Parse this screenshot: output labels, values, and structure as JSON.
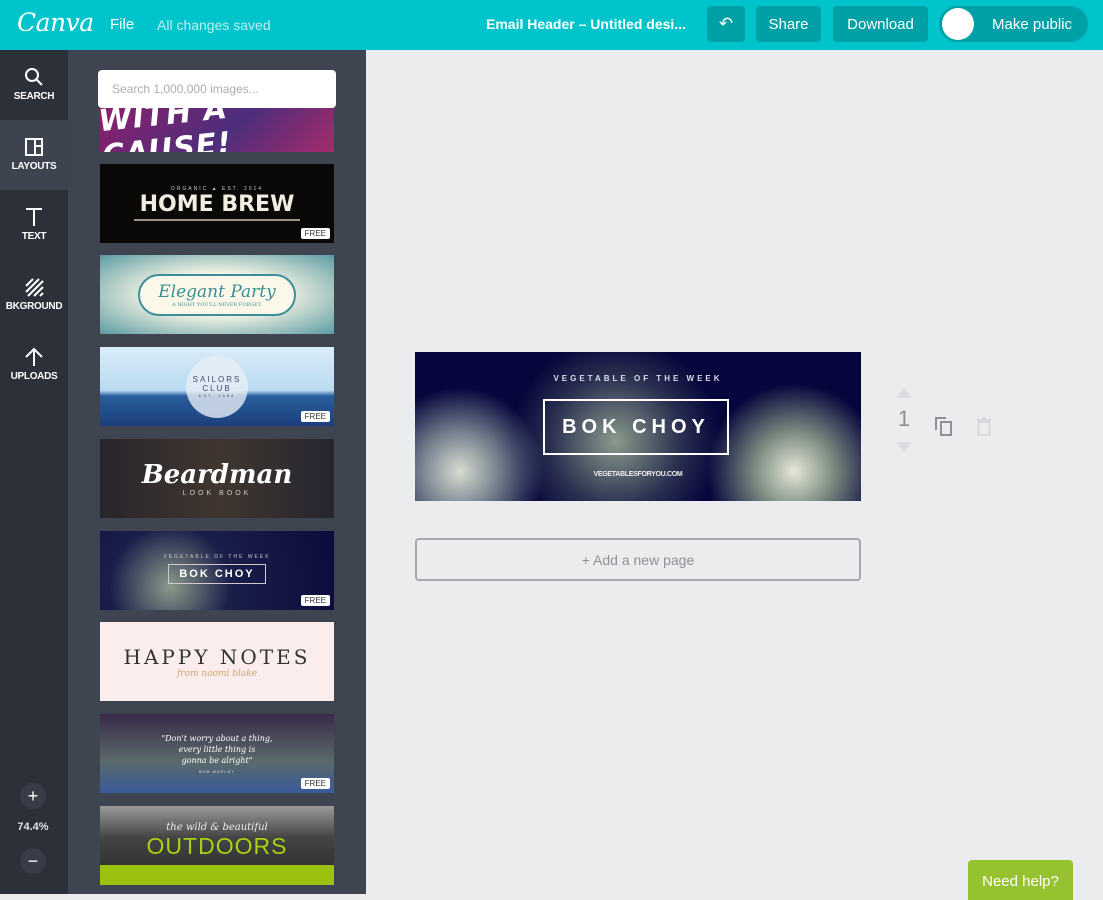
{
  "topbar": {
    "logo": "Canva",
    "file_menu": "File",
    "save_status": "All changes saved",
    "document_title": "Email Header – Untitled desi...",
    "undo_icon": "↶",
    "share_label": "Share",
    "download_label": "Download",
    "make_public_label": "Make public",
    "make_public_enabled": false,
    "colors": {
      "brand": "#00c4cc",
      "button": "#00a0a7"
    }
  },
  "rail": {
    "items": [
      {
        "label": "SEARCH",
        "icon": "search-icon"
      },
      {
        "label": "LAYOUTS",
        "icon": "layouts-icon",
        "active": true
      },
      {
        "label": "TEXT",
        "icon": "text-icon"
      },
      {
        "label": "BKGROUND",
        "icon": "background-icon"
      },
      {
        "label": "UPLOADS",
        "icon": "upload-icon"
      }
    ],
    "zoom_in": "+",
    "zoom_level": "74.4%",
    "zoom_out": "−"
  },
  "panel": {
    "search_placeholder": "Search 1,000,000 images...",
    "free_badge": "FREE",
    "layouts": [
      {
        "title": "WITH A CAUSE!",
        "free": false
      },
      {
        "small_left": "ORGANIC",
        "small_right": "EST. 2014",
        "title": "HOME BREW",
        "free": true
      },
      {
        "title": "Elegant Party",
        "subtitle": "A NIGHT YOU'LL NEVER FORGET.",
        "free": false
      },
      {
        "title": "SAILORS",
        "title2": "CLUB",
        "subtitle": "EST. 1984",
        "free": true
      },
      {
        "title": "Beardman",
        "subtitle": "LOOK BOOK",
        "free": false
      },
      {
        "kicker": "VEGETABLE OF THE WEEK",
        "title": "BOK CHOY",
        "free": true
      },
      {
        "title": "HAPPY NOTES",
        "subtitle": "from naomi blake",
        "free": false
      },
      {
        "quote_line1": "\"Don't worry about a thing,",
        "quote_line2": "every little thing is",
        "quote_line3": "gonna be alright\"",
        "author": "BOB MARLEY",
        "free": true
      },
      {
        "kicker": "the wild & beautiful",
        "title": "OUTDOORS",
        "free": false
      }
    ]
  },
  "canvas": {
    "design": {
      "kicker": "VEGETABLE OF THE WEEK",
      "headline": "BOK CHOY",
      "website": "VEGETABLESFORYOU.COM"
    },
    "page_number": "1",
    "add_page_label": "+ Add a new page"
  },
  "help": {
    "label": "Need help?",
    "color": "#97c230"
  }
}
